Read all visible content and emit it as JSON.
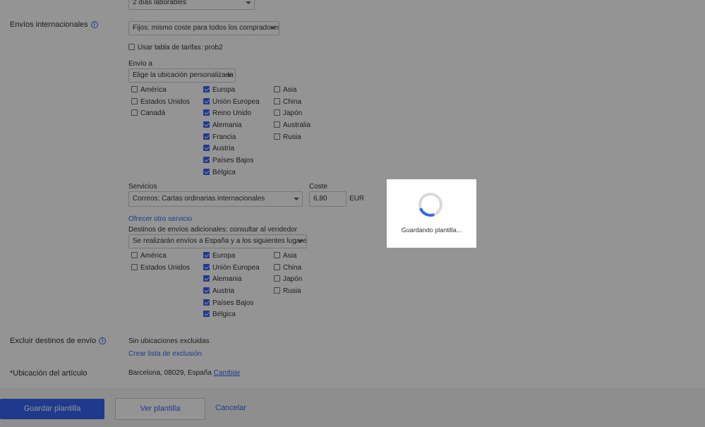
{
  "shipping": {
    "handling_time_value": "2 días laborables",
    "international_label": "Envíos internacionales",
    "info_glyph": "i",
    "cost_type_value": "Fijos: mismo coste para todos los compradores",
    "use_rate_table_label": "Usar tabla de tarifas: prob2",
    "ship_to_label": "Envío a",
    "ship_to_value": "Elige la ubicación personalizada",
    "regions": [
      {
        "label": "América",
        "checked": false
      },
      {
        "label": "Estados Unidos",
        "checked": false
      },
      {
        "label": "Canadá",
        "checked": false
      },
      {
        "label": "Europa",
        "checked": true
      },
      {
        "label": "Unión Europea",
        "checked": true
      },
      {
        "label": "Reino Unido",
        "checked": true
      },
      {
        "label": "Alemania",
        "checked": true
      },
      {
        "label": "Francia",
        "checked": true
      },
      {
        "label": "Austria",
        "checked": true
      },
      {
        "label": "Países Bajos",
        "checked": true
      },
      {
        "label": "Bélgica",
        "checked": true
      },
      {
        "label": "Asia",
        "checked": false
      },
      {
        "label": "China",
        "checked": false
      },
      {
        "label": "Japón",
        "checked": false
      },
      {
        "label": "Australia",
        "checked": false
      },
      {
        "label": "Rusia",
        "checked": false
      }
    ],
    "services_label": "Servicios",
    "services_value": "Correos: Cartas ordinarias internacionales",
    "cost_label": "Coste",
    "cost_value": "6,80",
    "currency": "EUR",
    "offer_other_service": "Ofrecer otro servicio",
    "additional_destinations_label": "Destinos de envíos adicionales: consultar al vendedor",
    "additional_destinations_value": "Se realizarán envíos a España y a los siguientes lugares",
    "additional_regions": [
      {
        "label": "América",
        "checked": false
      },
      {
        "label": "Estados Unidos",
        "checked": false
      },
      {
        "label": "Europa",
        "checked": true
      },
      {
        "label": "Unión Europea",
        "checked": true
      },
      {
        "label": "Alemania",
        "checked": true
      },
      {
        "label": "Austria",
        "checked": true
      },
      {
        "label": "Países Bajos",
        "checked": true
      },
      {
        "label": "Bélgica",
        "checked": true
      },
      {
        "label": "Asia",
        "checked": false
      },
      {
        "label": "China",
        "checked": false
      },
      {
        "label": "Japón",
        "checked": false
      },
      {
        "label": "Rusia",
        "checked": false
      }
    ],
    "exclude_label": "Excluir destinos de envío",
    "no_exclusions": "Sin ubicaciones excluidas",
    "create_exclusion_list": "Crear lista de exclusión",
    "item_location_label": "*Ubicación del artículo",
    "item_location_value": "Barcelona, 08029, España",
    "change_link": "Cambiar"
  },
  "actions": {
    "save_label": "Guardar plantilla",
    "view_label": "Ver plantilla",
    "cancel_label": "Cancelar"
  },
  "modal": {
    "message": "Guardando plantilla...",
    "spinner_progress": 0.25
  },
  "colors": {
    "accent": "#3665f3",
    "overlay": "rgba(0,0,0,0.42)"
  }
}
